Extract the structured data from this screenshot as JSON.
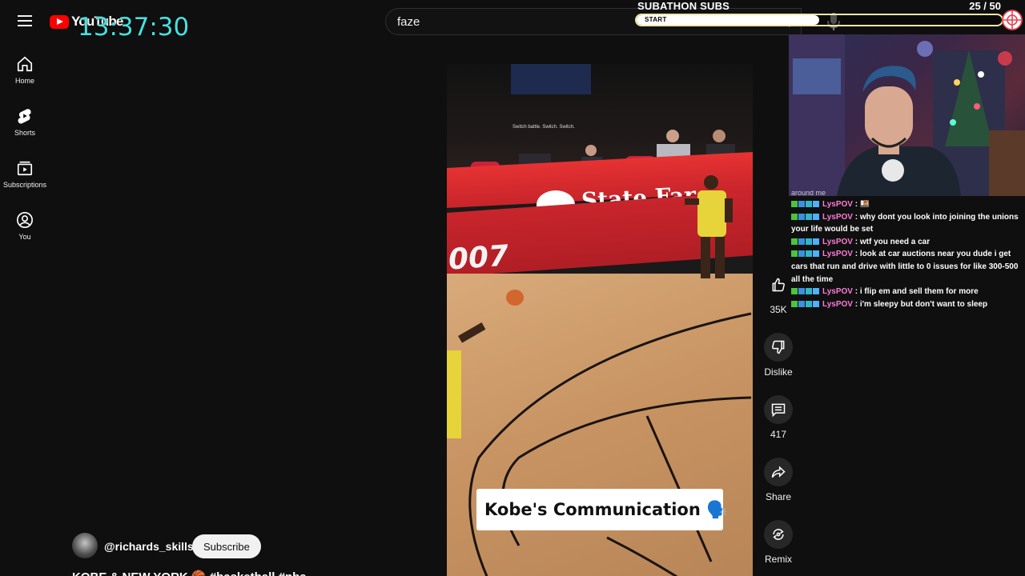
{
  "app": {
    "logo_text": "YouTube"
  },
  "overlay": {
    "clock": "13:37:30",
    "subathon_title": "SUBATHON SUBS",
    "subathon_count": "25  / 50",
    "subathon_start_label": "START",
    "subathon_progress_fraction": 0.5
  },
  "search": {
    "value": "faze"
  },
  "nav": {
    "items": [
      {
        "label": "Home",
        "icon": "home-icon"
      },
      {
        "label": "Shorts",
        "icon": "shorts-icon"
      },
      {
        "label": "Subscriptions",
        "icon": "subscriptions-icon"
      },
      {
        "label": "You",
        "icon": "user-icon"
      }
    ]
  },
  "video": {
    "small_caption": "Switch battle. Switch. Switch.",
    "banner_text": "State Far",
    "baseline_text": "007",
    "caption": "Kobe's Communication 🗣️"
  },
  "actions": {
    "like_count": "35K",
    "dislike_label": "Dislike",
    "comment_count": "417",
    "share_label": "Share",
    "remix_label": "Remix"
  },
  "chat": {
    "cut_line": "around me",
    "messages": [
      {
        "user": "LysPOV",
        "text": " : 🍱"
      },
      {
        "user": "LysPOV",
        "text": " : why dont you look into joining the unions your life would be set"
      },
      {
        "user": "LysPOV",
        "text": " : wtf you need a car"
      },
      {
        "user": "LysPOV",
        "text": " : look at car auctions near you dude i get cars that run and drive with little to 0 issues for like 300-500 all the time"
      },
      {
        "user": "LysPOV",
        "text": " : i flip em and sell them for more"
      },
      {
        "user": "LysPOV",
        "text": " : i'm sleepy but don't want to sleep"
      }
    ]
  },
  "channel": {
    "handle": "@richards_skills",
    "subscribe_label": "Subscribe",
    "title_cut": "KOBE & NEW YORK 🏀 #basketball #nba"
  },
  "colors": {
    "background": "#0f0f0f",
    "clock": "#47e0e0",
    "chat_user": "#ff7ad9",
    "youtube_red": "#ff0000"
  }
}
